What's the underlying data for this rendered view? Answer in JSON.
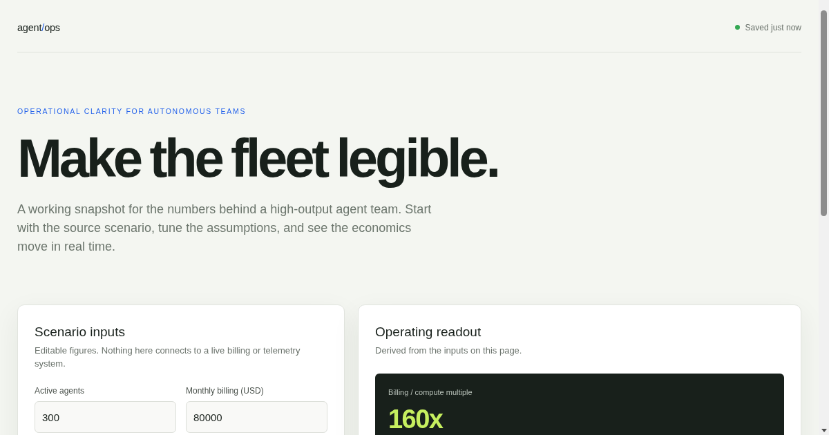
{
  "header": {
    "logo": {
      "text_before": "agent",
      "separator": "/",
      "text_after": "ops"
    },
    "save_status": "Saved just now"
  },
  "hero": {
    "eyebrow": "OPERATIONAL CLARITY FOR AUTONOMOUS TEAMS",
    "title": "Make the fleet legible.",
    "description": "A working snapshot for the numbers behind a high-output agent team. Start with the source scenario, tune the assumptions, and see the economics move in real time."
  },
  "panels": [
    {
      "kind": "inputs",
      "title": "Scenario inputs",
      "subtitle": "Editable figures. Nothing here connects to a live billing or telemetry system.",
      "fields": [
        {
          "label": "Active agents",
          "value": "300"
        },
        {
          "label": "Monthly billing (USD)",
          "value": "80000"
        }
      ]
    },
    {
      "kind": "readout",
      "title": "Operating readout",
      "subtitle": "Derived from the inputs on this page.",
      "metrics": [
        {
          "label": "Billing / compute multiple",
          "value": "160x"
        }
      ]
    }
  ]
}
